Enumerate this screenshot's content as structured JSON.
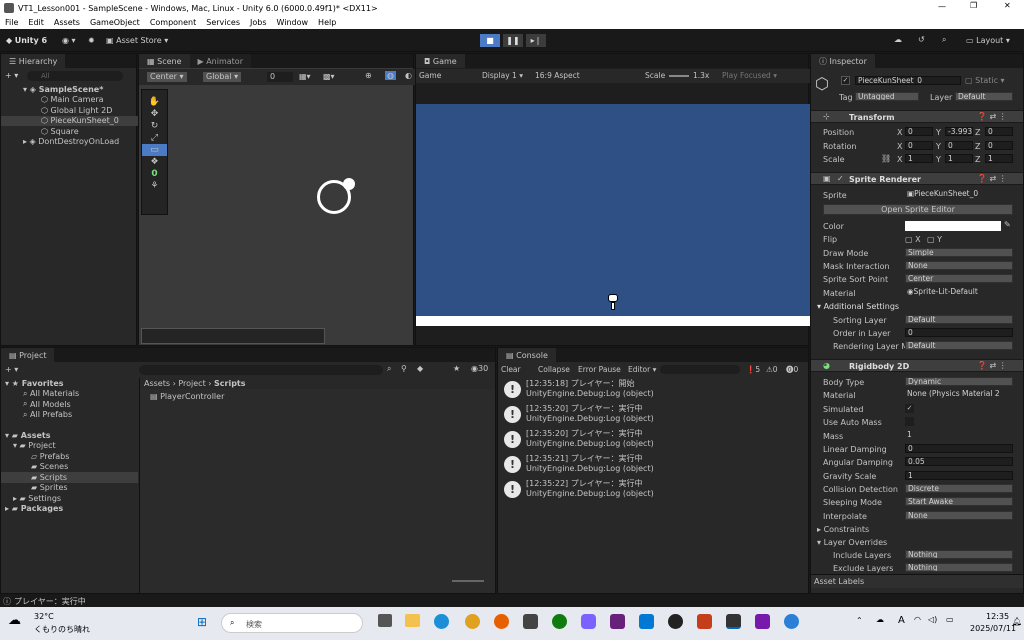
{
  "window": {
    "title": "VT1_Lesson001 - SampleScene - Windows, Mac, Linux - Unity 6.0 (6000.0.49f1)* <DX11>"
  },
  "menu": [
    "File",
    "Edit",
    "Assets",
    "GameObject",
    "Component",
    "Services",
    "Jobs",
    "Window",
    "Help"
  ],
  "toolbar": {
    "unity_label": "Unity 6",
    "asset_store": "Asset Store",
    "layout": "Layout"
  },
  "hierarchy": {
    "tab": "Hierarchy",
    "search": "All",
    "items": [
      "SampleScene*",
      "Main Camera",
      "Global Light 2D",
      "PieceKunSheet_0",
      "Square",
      "DontDestroyOnLoad"
    ]
  },
  "scene": {
    "tab_scene": "Scene",
    "tab_animator": "Animator",
    "pivot": "Center",
    "space": "Global",
    "snap": "0",
    "tool_count": "0"
  },
  "game": {
    "tab": "Game",
    "mode": "Game",
    "display": "Display 1",
    "aspect": "16:9 Aspect",
    "scale_label": "Scale",
    "scale_value": "1.3x",
    "play_focused": "Play Focused",
    "bg_color": "#2e5084"
  },
  "project": {
    "tab": "Project",
    "favorites": "Favorites",
    "fav_items": [
      "All Materials",
      "All Models",
      "All Prefabs"
    ],
    "assets": "Assets",
    "project_folder": "Project",
    "folders": [
      "Prefabs",
      "Scenes",
      "Scripts",
      "Sprites"
    ],
    "settings": "Settings",
    "packages": "Packages",
    "breadcrumb": [
      "Assets",
      "Project",
      "Scripts"
    ],
    "file": "PlayerController",
    "count": "30"
  },
  "console": {
    "tab": "Console",
    "clear": "Clear",
    "collapse": "Collapse",
    "error_pause": "Error Pause",
    "editor": "Editor",
    "count_log": "5",
    "count_warn": "0",
    "count_err": "0",
    "entries": [
      {
        "line1": "[12:35:18] プレイヤー：開始",
        "line2": "UnityEngine.Debug:Log (object)"
      },
      {
        "line1": "[12:35:20] プレイヤー：実行中",
        "line2": "UnityEngine.Debug:Log (object)"
      },
      {
        "line1": "[12:35:20] プレイヤー：実行中",
        "line2": "UnityEngine.Debug:Log (object)"
      },
      {
        "line1": "[12:35:21] プレイヤー：実行中",
        "line2": "UnityEngine.Debug:Log (object)"
      },
      {
        "line1": "[12:35:22] プレイヤー：実行中",
        "line2": "UnityEngine.Debug:Log (object)"
      }
    ]
  },
  "inspector": {
    "tab": "Inspector",
    "name": "PieceKunSheet_0",
    "static": "Static",
    "tag_label": "Tag",
    "tag": "Untagged",
    "layer_label": "Layer",
    "layer": "Default",
    "transform": {
      "title": "Transform",
      "position_label": "Position",
      "position": [
        "0",
        "-3.993",
        "0"
      ],
      "rotation_label": "Rotation",
      "rotation": [
        "0",
        "0",
        "0"
      ],
      "scale_label": "Scale",
      "scale": [
        "1",
        "1",
        "1"
      ]
    },
    "sprite_renderer": {
      "title": "Sprite Renderer",
      "sprite_label": "Sprite",
      "sprite": "PieceKunSheet_0",
      "open_editor": "Open Sprite Editor",
      "color_label": "Color",
      "flip_label": "Flip",
      "flip_x": "X",
      "flip_y": "Y",
      "draw_mode_label": "Draw Mode",
      "draw_mode": "Simple",
      "mask_label": "Mask Interaction",
      "mask": "None",
      "sort_point_label": "Sprite Sort Point",
      "sort_point": "Center",
      "material_label": "Material",
      "material": "Sprite-Lit-Default",
      "additional": "Additional Settings",
      "sorting_layer_label": "Sorting Layer",
      "sorting_layer": "Default",
      "order_label": "Order in Layer",
      "order": "0",
      "rendering_layer_label": "Rendering Layer M",
      "rendering_layer": "Default"
    },
    "rigidbody": {
      "title": "Rigidbody 2D",
      "body_type_label": "Body Type",
      "body_type": "Dynamic",
      "material_label": "Material",
      "material": "None (Physics Material 2",
      "simulated_label": "Simulated",
      "auto_mass_label": "Use Auto Mass",
      "mass_label": "Mass",
      "mass": "1",
      "linear_label": "Linear Damping",
      "linear": "0",
      "angular_label": "Angular Damping",
      "angular": "0.05",
      "gravity_label": "Gravity Scale",
      "gravity": "1",
      "collision_label": "Collision Detection",
      "collision": "Discrete",
      "sleep_label": "Sleeping Mode",
      "sleep": "Start Awake",
      "interp_label": "Interpolate",
      "interp": "None",
      "constraints": "Constraints",
      "layer_overrides": "Layer Overrides",
      "include_label": "Include Layers",
      "include": "Nothing",
      "exclude_label": "Exclude Layers",
      "exclude": "Nothing"
    },
    "asset_labels": "Asset Labels"
  },
  "statusbar": {
    "text": "プレイヤー：実行中"
  },
  "taskbar": {
    "weather_temp": "32°C",
    "weather_desc": "くもりのち晴れ",
    "search": "検索",
    "time": "12:35",
    "date": "2025/07/11",
    "ime": "A"
  }
}
